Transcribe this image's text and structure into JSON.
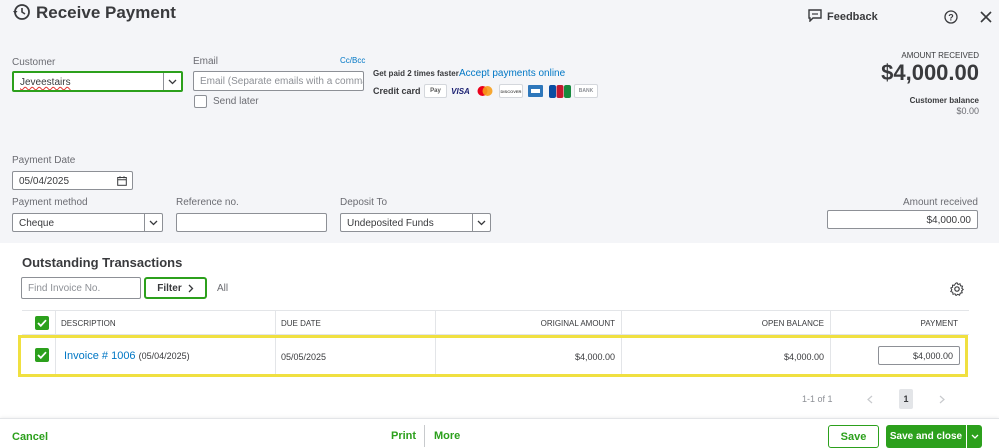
{
  "header": {
    "title": "Receive Payment",
    "feedback_label": "Feedback"
  },
  "customer": {
    "label": "Customer",
    "value": "Jeveestairs"
  },
  "email": {
    "label": "Email",
    "cc_bcc": "Cc/Bcc",
    "placeholder": "Email (Separate emails with a comma)",
    "send_later": "Send later"
  },
  "promo": {
    "text": "Get paid 2 times faster",
    "link": "Accept payments online",
    "credit_card_label": "Credit card",
    "cards": [
      "Pay",
      "VISA",
      "",
      "DISCOVER",
      "",
      "JCB",
      "BANK"
    ]
  },
  "amount_received_summary": {
    "label": "AMOUNT RECEIVED",
    "amount": "$4,000.00",
    "balance_label": "Customer balance",
    "balance_value": "$0.00"
  },
  "payment_date": {
    "label": "Payment Date",
    "value": "05/04/2025"
  },
  "payment_method": {
    "label": "Payment method",
    "value": "Cheque"
  },
  "reference": {
    "label": "Reference no.",
    "value": ""
  },
  "deposit_to": {
    "label": "Deposit To",
    "value": "Undeposited Funds"
  },
  "amount_received_field": {
    "label": "Amount received",
    "value": "$4,000.00"
  },
  "outstanding": {
    "title": "Outstanding Transactions",
    "find_placeholder": "Find Invoice No.",
    "filter_label": "Filter",
    "all_label": "All",
    "columns": [
      "DESCRIPTION",
      "DUE DATE",
      "ORIGINAL AMOUNT",
      "OPEN BALANCE",
      "PAYMENT"
    ],
    "rows": [
      {
        "invoice": "Invoice # 1006",
        "invoice_date": "(05/04/2025)",
        "due_date": "05/05/2025",
        "original_amount": "$4,000.00",
        "open_balance": "$4,000.00",
        "payment": "$4,000.00"
      }
    ],
    "pagination": {
      "range": "1-1 of 1",
      "page": "1"
    }
  },
  "footer": {
    "cancel": "Cancel",
    "print": "Print",
    "more": "More",
    "save": "Save",
    "save_close": "Save and close"
  },
  "colors": {
    "brand_green": "#2ca01c",
    "link_blue": "#0077c5",
    "highlight_yellow": "#f0e040"
  }
}
